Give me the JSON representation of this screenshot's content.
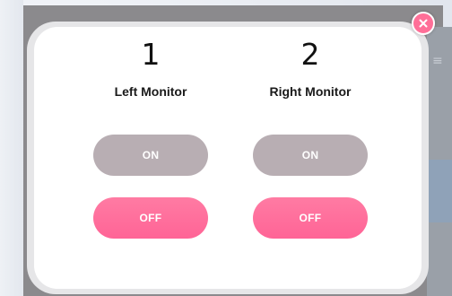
{
  "colors": {
    "accent": "#ff6f98",
    "on_button": "#b8aeb3",
    "off_button": "#ff6d9c"
  },
  "close": {
    "icon": "close-icon"
  },
  "monitors": [
    {
      "number": "1",
      "name": "Left Monitor",
      "on_label": "ON",
      "off_label": "OFF"
    },
    {
      "number": "2",
      "name": "Right Monitor",
      "on_label": "ON",
      "off_label": "OFF"
    }
  ]
}
